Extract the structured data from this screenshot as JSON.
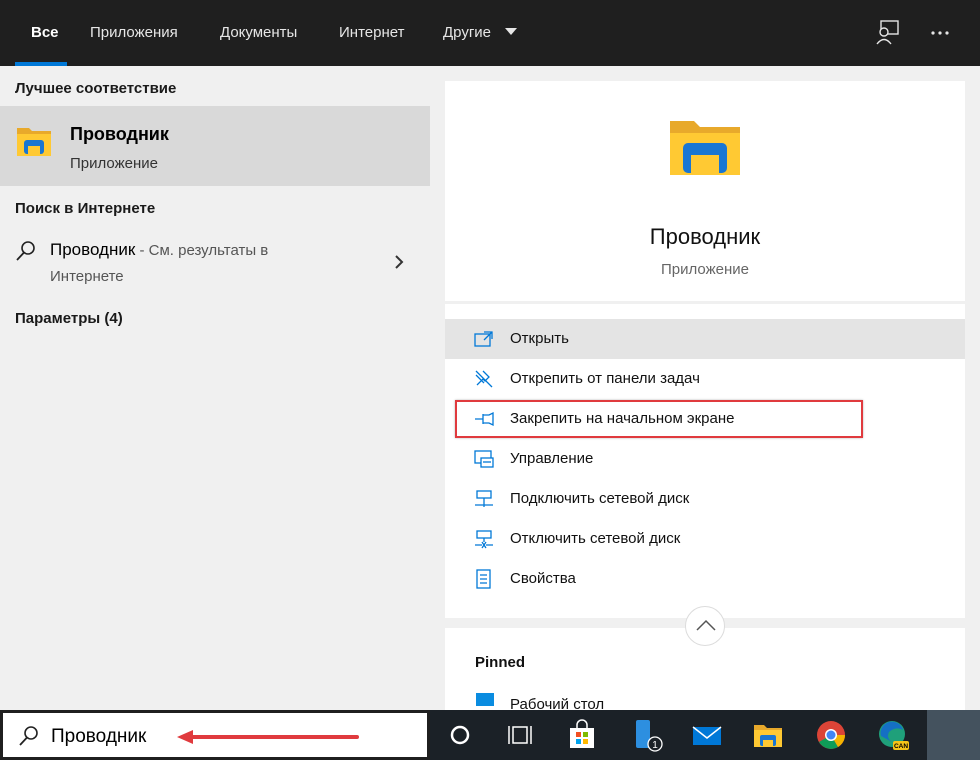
{
  "topbar": {
    "tabs": [
      {
        "label": "Все"
      },
      {
        "label": "Приложения"
      },
      {
        "label": "Документы"
      },
      {
        "label": "Интернет"
      },
      {
        "label": "Другие"
      }
    ],
    "feedback_icon": "feedback-person-icon",
    "more_icon": "more-dots-icon",
    "accent_color": "#0078d7"
  },
  "left": {
    "best_match_heading": "Лучшее соответствие",
    "best_match": {
      "title": "Проводник",
      "subtitle": "Приложение",
      "icon": "folder-icon"
    },
    "web_heading": "Поиск в Интернете",
    "web_result": {
      "title": "Проводник",
      "suffix": " - См. результаты в",
      "line2": "Интернете",
      "icon": "search-icon"
    },
    "settings_heading": "Параметры (4)"
  },
  "right": {
    "app_title": "Проводник",
    "app_subtitle": "Приложение",
    "actions": [
      {
        "label": "Открыть",
        "icon": "open-icon"
      },
      {
        "label": "Открепить от панели задач",
        "icon": "unpin-icon"
      },
      {
        "label": "Закрепить на начальном экране",
        "icon": "pin-icon"
      },
      {
        "label": "Управление",
        "icon": "manage-icon"
      },
      {
        "label": "Подключить сетевой диск",
        "icon": "map-drive-icon"
      },
      {
        "label": "Отключить сетевой диск",
        "icon": "disconnect-drive-icon"
      },
      {
        "label": "Свойства",
        "icon": "properties-icon"
      }
    ],
    "pinned_heading": "Pinned",
    "pinned_items": [
      {
        "label": "Рабочий стол",
        "icon": "desktop-icon"
      }
    ],
    "highlight_color": "#e03a3e"
  },
  "search": {
    "value": "Проводник",
    "icon": "search-icon"
  },
  "taskbar": {
    "icons": [
      "cortana-icon",
      "task-view-icon",
      "store-icon",
      "phone-icon",
      "mail-icon",
      "file-explorer-icon",
      "chrome-icon",
      "edge-canary-icon"
    ],
    "phone_badge": "1",
    "edge_badge": "CAN"
  }
}
